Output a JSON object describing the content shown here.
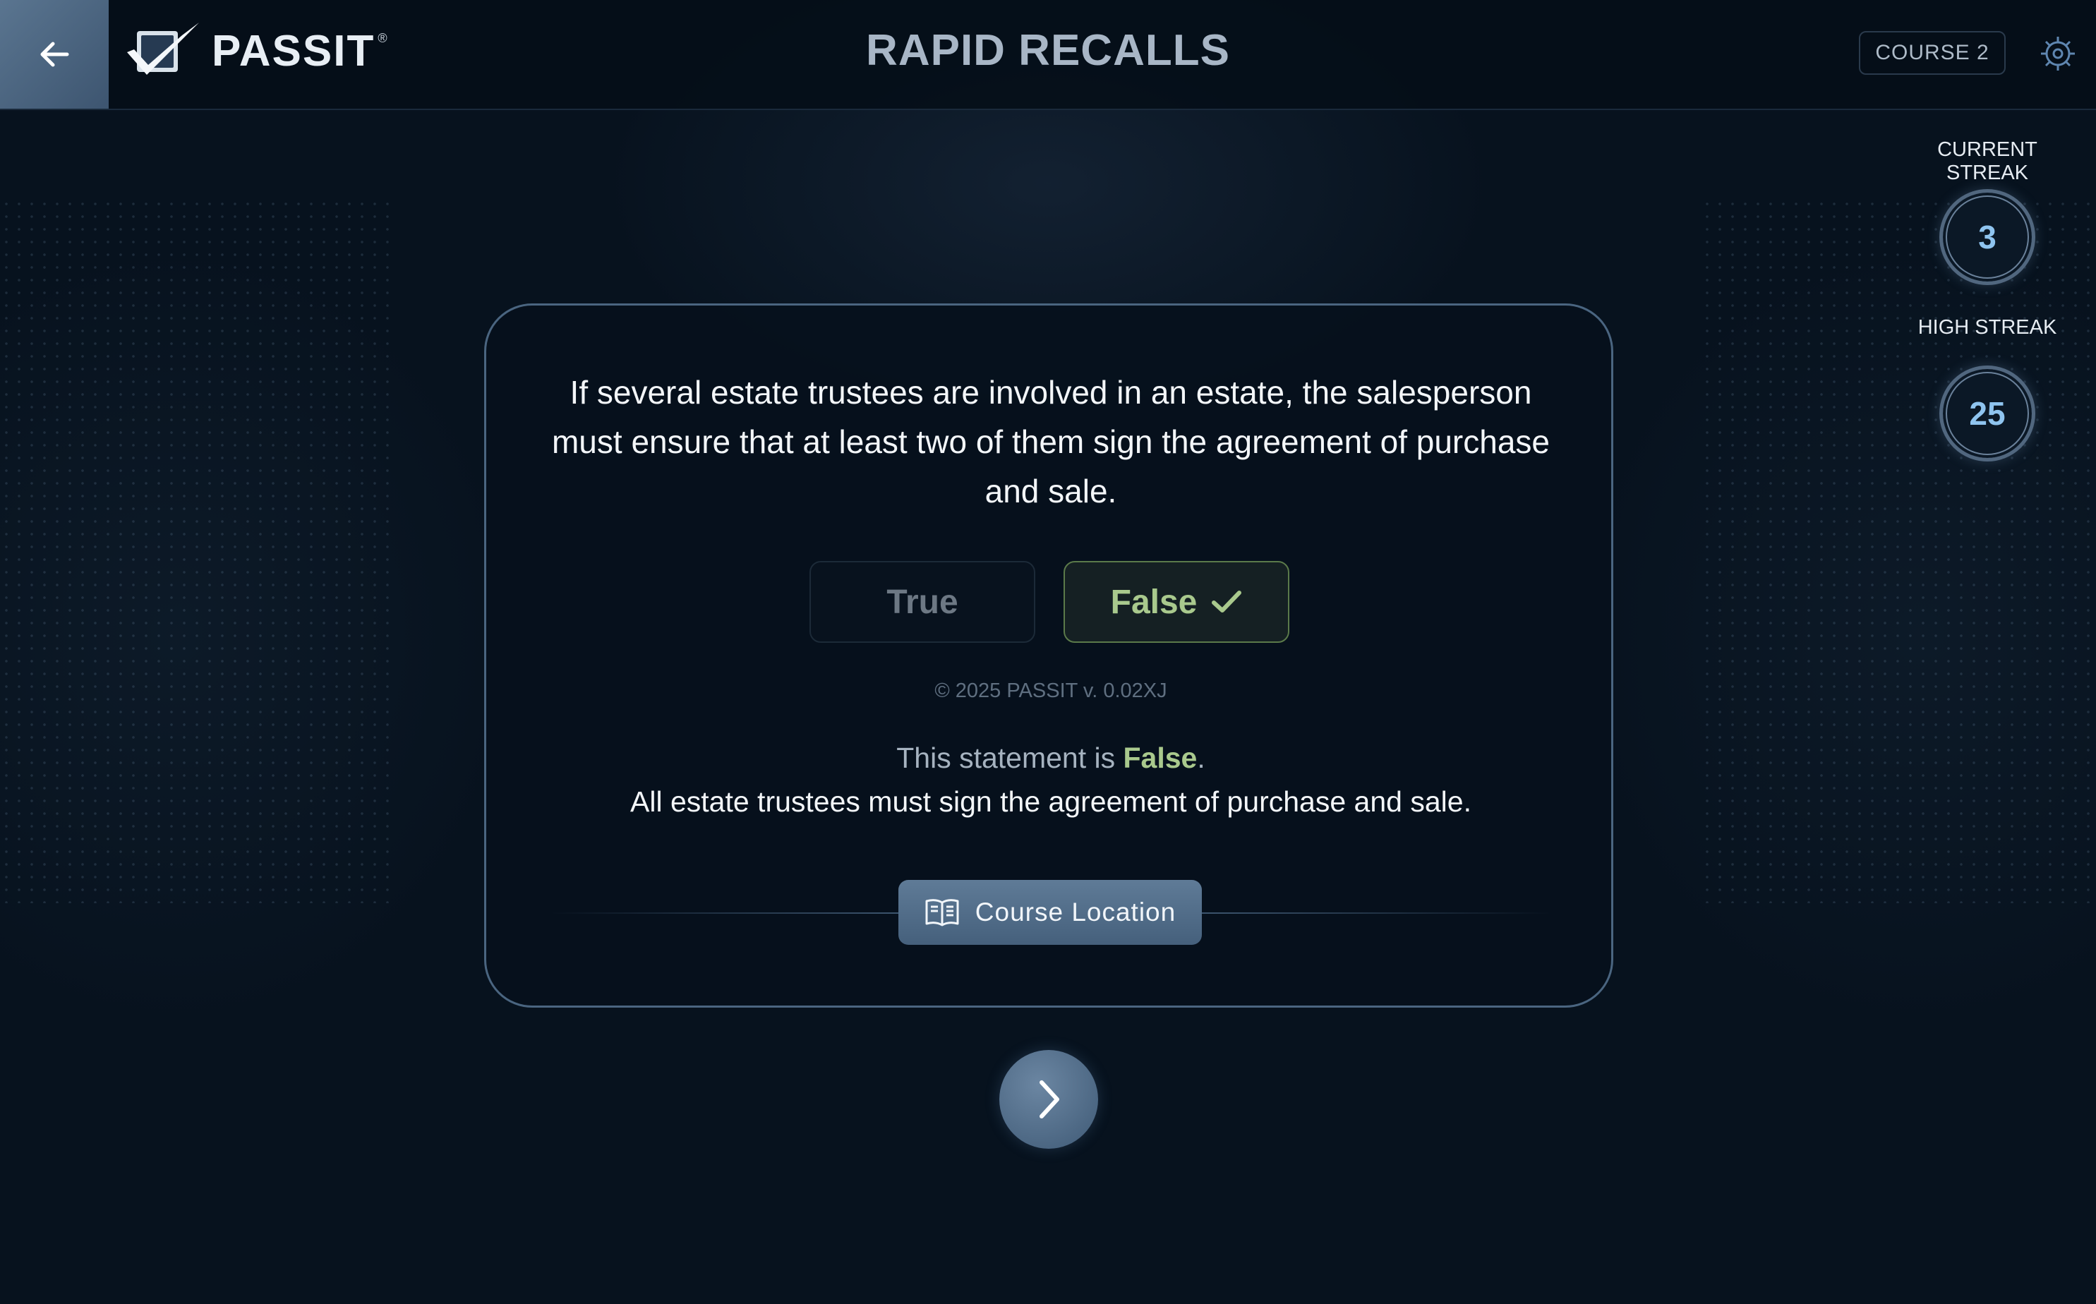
{
  "app": {
    "logo_text": "PASSIT",
    "logo_mark": "®",
    "title": "RAPID RECALLS",
    "course_label": "COURSE 2"
  },
  "streaks": {
    "current_label": "CURRENT STREAK",
    "current_value": "3",
    "high_label": "HIGH STREAK",
    "high_value": "25"
  },
  "question": {
    "text": "If several estate trustees are involved in an estate, the salesperson must ensure that at least two of them sign the agreement of purchase and sale.",
    "options": [
      {
        "label": "True",
        "state": "unselected"
      },
      {
        "label": "False",
        "state": "correct-selected"
      }
    ]
  },
  "footer": {
    "copyright": "© 2025 PASSIT v. 0.02XJ"
  },
  "result": {
    "prefix": "This statement is ",
    "answer": "False",
    "suffix": ".",
    "explanation": "All estate trustees must sign the agreement of purchase and sale."
  },
  "actions": {
    "course_location_label": "Course Location"
  },
  "icons": {
    "back": "arrow-left-icon",
    "settings": "gear-icon",
    "check": "checkmark-icon",
    "book": "open-book-icon",
    "next": "chevron-right-icon"
  },
  "colors": {
    "background": "#07121e",
    "accent_correct": "#a9c98d",
    "streak_value": "#8fc4ef",
    "button_blue": "#5f7b97"
  }
}
